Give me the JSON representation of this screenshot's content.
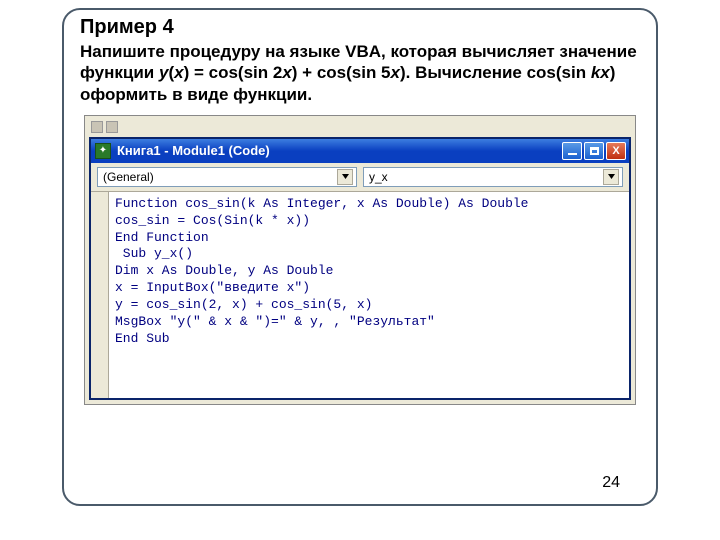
{
  "heading": "Пример 4",
  "task_html_parts": {
    "p1": "Напишите процедуру на языке VBA, которая вычисляет значение функции ",
    "p2": "y",
    "p3": "(",
    "p4": "x",
    "p5": ") = cos(sin 2",
    "p6": "x",
    "p7": ") + cos(sin 5",
    "p8": "x",
    "p9": "). Вычисление cos(sin ",
    "p10": "kx",
    "p11": ") оформить в виде функции."
  },
  "window": {
    "title": "Книга1 - Module1 (Code)",
    "dropdown_left": "(General)",
    "dropdown_right": "y_x"
  },
  "code_lines": [
    "Function cos_sin(k As Integer, x As Double) As Double",
    "cos_sin = Cos(Sin(k * x))",
    "End Function",
    " Sub y_x()",
    "Dim x As Double, y As Double",
    "x = InputBox(\"введите x\")",
    "y = cos_sin(2, x) + cos_sin(5, x)",
    "MsgBox \"y(\" & x & \")=\" & y, , \"Результат\"",
    "End Sub"
  ],
  "page_number": "24"
}
